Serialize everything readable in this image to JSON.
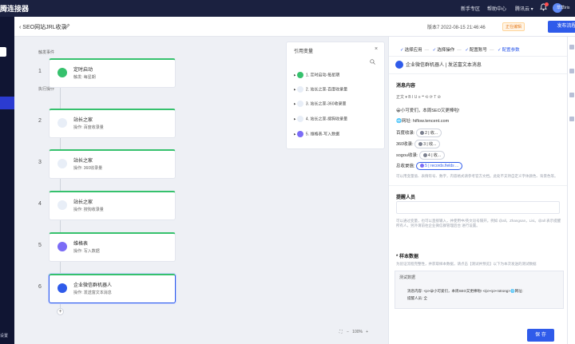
{
  "topbar": {
    "brand": "腾连接器",
    "links": [
      "新手专区",
      "帮助中心",
      "腾讯云 ▾"
    ],
    "user": "草草iris"
  },
  "sidebar": {
    "bottom_text": "设置"
  },
  "subheader": {
    "back_label": "SEO网站JRL收录",
    "version": "版本7  2022-08-15 21:46:46",
    "status": "正在编辑",
    "publish_label": "发布流程"
  },
  "canvas": {
    "trigger_label": "触发事件",
    "action_label": "执行操作",
    "nodes": [
      {
        "num": "1",
        "title": "定时启动",
        "sub": "触发: 每星期",
        "color": "#36c16d"
      },
      {
        "num": "2",
        "title": "站长之家",
        "sub": "操作: 百度收录量",
        "color": "#e8eef7"
      },
      {
        "num": "3",
        "title": "站长之家",
        "sub": "操作: 360收录量",
        "color": "#e8eef7"
      },
      {
        "num": "4",
        "title": "站长之家",
        "sub": "操作: 搜狗收录量",
        "color": "#e8eef7"
      },
      {
        "num": "5",
        "title": "维格表",
        "sub": "操作: 写入数据",
        "color": "#7b6cf6"
      },
      {
        "num": "6",
        "title": "企业微信群机器人",
        "sub": "操作: 发送富文本消息",
        "color": "#2f5bea"
      }
    ],
    "plus": "+",
    "zoom": "100%"
  },
  "var_panel": {
    "title": "引用变量",
    "close": "×",
    "items": [
      {
        "label": "1. 定时启动-每星期",
        "color": "#36c16d"
      },
      {
        "label": "2. 站长之家-百度收录量",
        "color": "#e8eef7"
      },
      {
        "label": "3. 站长之家-360收录量",
        "color": "#e8eef7"
      },
      {
        "label": "4. 站长之家-搜狗收录量",
        "color": "#e8eef7"
      },
      {
        "label": "5. 维格表-写入数据",
        "color": "#7b6cf6"
      }
    ]
  },
  "right_panel": {
    "steps": [
      "选择应用",
      "选择操作",
      "配置账号",
      "配置参数"
    ],
    "app_title": "企业微信群机器人  |  发送富文本消息",
    "message_label": "消息内容",
    "toolbar": "正文 ▾    B   I   U   ≡   ❝   ⟲   ⟳   T   ⊘",
    "lines": [
      "😀小可爱们，本周SEO又更棒啦!",
      "🌐网址: hiflow.tencent.com"
    ],
    "rows": [
      {
        "label": "百度收录:",
        "tag": "2 | 收..."
      },
      {
        "label": "360收录:",
        "tag": "3 | 收..."
      },
      {
        "label": "sogou收录:",
        "tag": "4 | 收..."
      },
      {
        "label": "总收录值:",
        "tag": "5 | records.fields ..."
      }
    ],
    "msg_hint": "可以用变量值、表情符号、数字，内容格式请参考官方文档。此处不支持自定义字体颜色、背景色等。",
    "mention_label": "提醒人员",
    "mention_hint": "可以通过变量，也可以直接输入，并使用中/英文逗号隔开。例如 @all，Zhangsan，Lisi。@all 表示提醒所有人，另外请前往企业微信群管理后台 进行设置。",
    "mention_link": "企业微信群管理后台",
    "sample_label": "* 样本数据",
    "sample_hint": "为验证流程完整性，并获取样本数据，请点击【测试并预览】以下为本次发送的测试数据",
    "sample_box_title": "测试数据",
    "sample_lines": [
      "消息内容: <p>😀小可爱们，本周SEO又更棒啦! </p><p><strong>🌐网址:",
      "提醒人员: 全"
    ],
    "save_label": "保 存"
  }
}
